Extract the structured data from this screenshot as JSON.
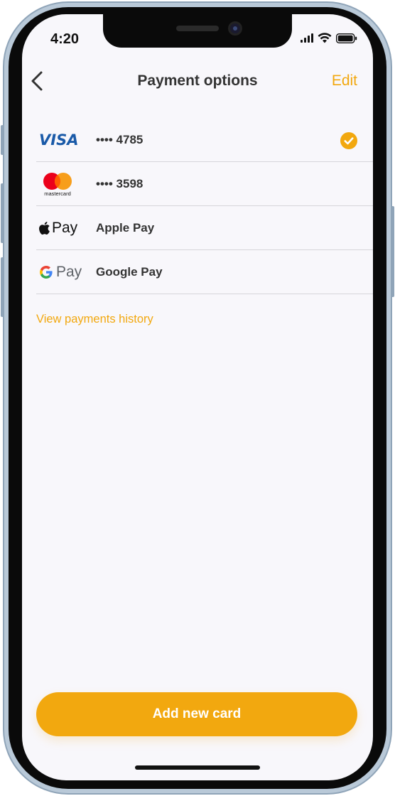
{
  "status_bar": {
    "time": "4:20"
  },
  "header": {
    "title": "Payment options",
    "edit_label": "Edit"
  },
  "payment_methods": [
    {
      "brand": "VISA",
      "label": "•••• 4785",
      "selected": true
    },
    {
      "brand": "mastercard",
      "label": "•••• 3598",
      "selected": false
    },
    {
      "brand": "Pay",
      "label": "Apple Pay",
      "selected": false
    },
    {
      "brand": "Pay",
      "label": "Google Pay",
      "selected": false
    }
  ],
  "links": {
    "history": "View payments history"
  },
  "actions": {
    "add_card": "Add new card"
  },
  "colors": {
    "accent": "#f2a80f",
    "screen_bg": "#f8f7fb",
    "text": "#333333",
    "visa_blue": "#1a5aa8"
  }
}
